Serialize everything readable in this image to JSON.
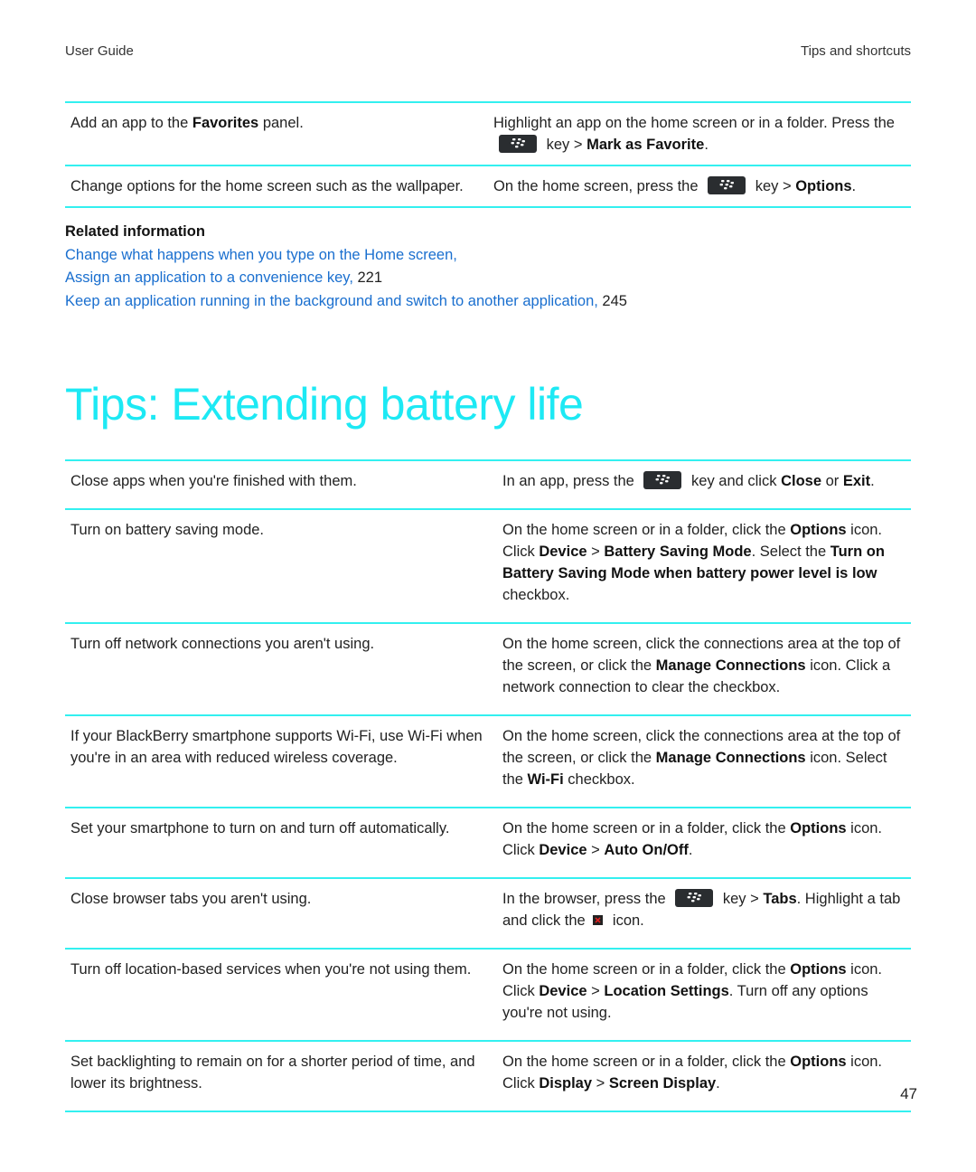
{
  "header": {
    "left": "User Guide",
    "right": "Tips and shortcuts"
  },
  "accent_color": "#33f0f0",
  "title_color": "#1de9f4",
  "link_color": "#1a6fcf",
  "top_table": [
    {
      "task": [
        "Add an app to the ",
        {
          "b": "Favorites"
        },
        " panel."
      ],
      "action": [
        "Highlight an app on the home screen or in a folder. Press the ",
        {
          "icon": "blackberry-menu-key"
        },
        " key > ",
        {
          "b": "Mark as Favorite"
        },
        "."
      ]
    },
    {
      "task": [
        "Change options for the home screen such as the wallpaper."
      ],
      "action": [
        "On the home screen, press the ",
        {
          "icon": "blackberry-menu-key"
        },
        " key > ",
        {
          "b": "Options"
        },
        "."
      ]
    }
  ],
  "related": {
    "heading": "Related information",
    "links": [
      {
        "text": "Change what happens when you type on the Home screen,",
        "page": ""
      },
      {
        "text": "Assign an application to a convenience key,",
        "page": "221"
      },
      {
        "text": "Keep an application running in the background and switch to another application,",
        "page": "245"
      }
    ]
  },
  "section_title": "Tips: Extending battery life",
  "battery_table": [
    {
      "task": [
        "Close apps when you're finished with them."
      ],
      "action": [
        "In an app, press the ",
        {
          "icon": "blackberry-menu-key"
        },
        " key and click ",
        {
          "b": "Close"
        },
        " or ",
        {
          "b": "Exit"
        },
        "."
      ]
    },
    {
      "task": [
        "Turn on battery saving mode."
      ],
      "action": [
        "On the home screen or in a folder, click the ",
        {
          "b": "Options"
        },
        " icon. Click ",
        {
          "b": "Device"
        },
        " > ",
        {
          "b": "Battery Saving Mode"
        },
        ". Select the ",
        {
          "b": "Turn on Battery Saving Mode when battery power level is low"
        },
        " checkbox."
      ]
    },
    {
      "task": [
        "Turn off network connections you aren't using."
      ],
      "action": [
        "On the home screen, click the connections area at the top of the screen, or click the ",
        {
          "b": "Manage Connections"
        },
        " icon. Click a network connection to clear the checkbox."
      ]
    },
    {
      "task": [
        "If your BlackBerry smartphone supports Wi-Fi, use Wi-Fi when you're in an area with reduced wireless coverage."
      ],
      "action": [
        "On the home screen, click the connections area at the top of the screen, or click the ",
        {
          "b": "Manage Connections"
        },
        " icon. Select the ",
        {
          "b": "Wi-Fi"
        },
        " checkbox."
      ]
    },
    {
      "task": [
        "Set your smartphone to turn on and turn off automatically."
      ],
      "action": [
        "On the home screen or in a folder, click the ",
        {
          "b": "Options"
        },
        " icon. Click ",
        {
          "b": "Device"
        },
        " > ",
        {
          "b": "Auto On/Off"
        },
        "."
      ]
    },
    {
      "task": [
        "Close browser tabs you aren't using."
      ],
      "action": [
        "In the browser, press the ",
        {
          "icon": "blackberry-menu-key"
        },
        " key > ",
        {
          "b": "Tabs"
        },
        ". Highlight a tab and click the ",
        {
          "icon": "close-tab"
        },
        " icon."
      ]
    },
    {
      "task": [
        "Turn off location-based services when you're not using them."
      ],
      "action": [
        "On the home screen or in a folder, click the ",
        {
          "b": "Options"
        },
        " icon. Click ",
        {
          "b": "Device"
        },
        " > ",
        {
          "b": "Location Settings"
        },
        ". Turn off any options you're not using."
      ]
    },
    {
      "task": [
        "Set backlighting to remain on for a shorter period of time, and lower its brightness."
      ],
      "action": [
        "On the home screen or in a folder, click the ",
        {
          "b": "Options"
        },
        " icon. Click ",
        {
          "b": "Display"
        },
        " > ",
        {
          "b": "Screen Display"
        },
        "."
      ]
    }
  ],
  "page_number": "47"
}
